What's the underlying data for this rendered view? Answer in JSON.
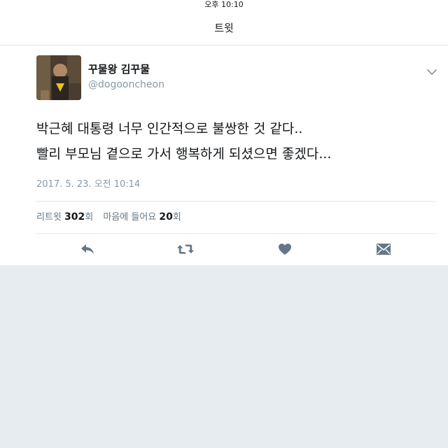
{
  "status_bar": {
    "time": "오후 10:10"
  },
  "header": {
    "title": "트윗"
  },
  "tweet": {
    "display_name": "꾸물왕 김꾸물",
    "username": "@dogooncheon",
    "lines": [
      "박근혜 대통령 너무 인간적으로 불쌍한 것 같다..",
      "빨리 부모님 곁으로 가서 행복하게 되셨으면 좋겠다..."
    ],
    "timestamp": "2017. 5. 23. 오전 10:14",
    "stats": {
      "retweets_label": "리트윗",
      "retweets_count": "302",
      "retweets_unit": "회",
      "likes_label": "마음에 들어요",
      "likes_count": "20",
      "likes_unit": "회"
    },
    "actions": [
      "reply-icon",
      "retweet-icon",
      "heart-icon",
      "direct-message-icon"
    ]
  },
  "colors": {
    "text": "#14171a",
    "secondary": "#8899a6",
    "icon": "#657786",
    "background": "#e6ecf0"
  }
}
